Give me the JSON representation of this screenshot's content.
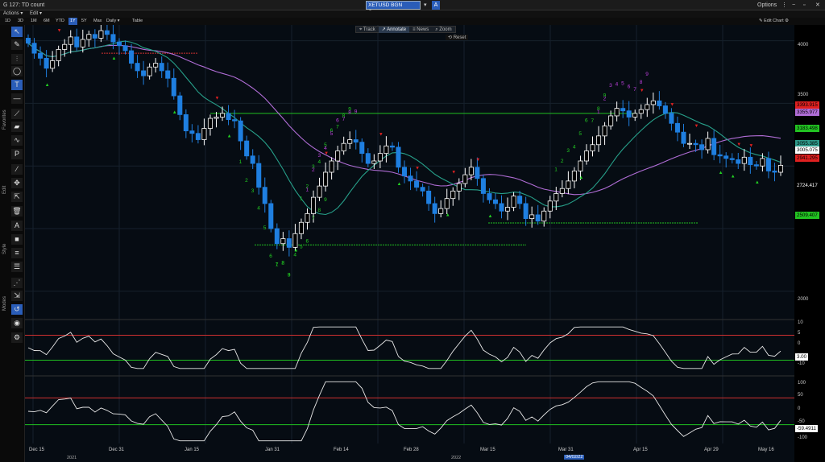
{
  "window": {
    "title": "G 127: TD count",
    "ticker": "XETUSD BGN Curncy",
    "ticker_badge": "A",
    "options_label": "Options",
    "btn_menu": "⋮",
    "btn_min": "−",
    "btn_max": "▫",
    "btn_close": "✕"
  },
  "menu": {
    "actions": "Actions ▾",
    "edit": "Edit ▾"
  },
  "ranges": [
    "1D",
    "3D",
    "1M",
    "6M",
    "YTD",
    "1Y",
    "5Y",
    "Max",
    "Daily ▾",
    "Table"
  ],
  "active_range": "1Y",
  "edit_chart": "✎ Edit Chart ⚙",
  "chart_toolbar": {
    "track": "⌖ Track",
    "annotate": "↗ Annotate",
    "news": "≡ News",
    "zoom": "⌕ Zoom",
    "reset": "⟲ Reset"
  },
  "sidebar": {
    "favorites_label": "Favorites",
    "edit_label": "Edit",
    "style_label": "Style",
    "modes_label": "Modes"
  },
  "colors": {
    "up_candle": "#ffffff",
    "down_candle": "#1f7fe0",
    "ma_fast": "#27a08a",
    "ma_slow": "#b06dd6",
    "resist_line": "#20c020",
    "red_line": "#d03030",
    "accent": "#2a5db8"
  },
  "price_labels": [
    {
      "text": "3393.915",
      "bg": "#e02020",
      "fg": "#000"
    },
    {
      "text": "3355.977",
      "bg": "#b06dd6",
      "fg": "#000"
    },
    {
      "text": "3183.498",
      "bg": "#22c322",
      "fg": "#000"
    },
    {
      "text": "3055.385",
      "bg": "#2e9a8a",
      "fg": "#000"
    },
    {
      "text": "3005.075",
      "bg": "#ffffff",
      "fg": "#000"
    },
    {
      "text": "2941.295",
      "bg": "#e02020",
      "fg": "#000"
    },
    {
      "text": "2724.417",
      "bg": "#000000",
      "fg": "#ffffff"
    },
    {
      "text": "2509.407",
      "bg": "#22c322",
      "fg": "#000"
    }
  ],
  "osc1_value": "3.00",
  "osc2_value": "-59.4911",
  "xaxis": {
    "labels": [
      "Dec 15",
      "Dec 31",
      "Jan 15",
      "Jan 31",
      "Feb 14",
      "Feb 28",
      "Mar 15",
      "Mar 31",
      "Apr 15",
      "Apr 29",
      "May 16"
    ],
    "years": [
      "2021",
      "2022"
    ],
    "cursor_date": "04/02/22"
  },
  "chart_data": {
    "type": "line",
    "ylim": [
      1800,
      4100
    ],
    "yticks": [
      2000,
      2500,
      3000,
      3500,
      4000
    ],
    "close": [
      3980,
      3900,
      3860,
      3780,
      3840,
      3930,
      3970,
      4030,
      3950,
      4010,
      4050,
      4020,
      4080,
      4050,
      3990,
      3960,
      3920,
      3820,
      3760,
      3720,
      3790,
      3820,
      3760,
      3700,
      3560,
      3410,
      3280,
      3260,
      3210,
      3300,
      3380,
      3390,
      3420,
      3370,
      3360,
      3200,
      3080,
      3020,
      2830,
      2700,
      2500,
      2380,
      2420,
      2350,
      2460,
      2550,
      2620,
      2750,
      2840,
      2950,
      3040,
      3120,
      3180,
      3210,
      3190,
      3100,
      3020,
      3040,
      3100,
      3160,
      3150,
      2990,
      2920,
      2880,
      2830,
      2800,
      2700,
      2620,
      2660,
      2740,
      2800,
      2860,
      2930,
      2990,
      2900,
      2780,
      2730,
      2700,
      2640,
      2670,
      2760,
      2700,
      2580,
      2610,
      2560,
      2640,
      2720,
      2780,
      2820,
      2880,
      2960,
      3040,
      3120,
      3170,
      3240,
      3320,
      3400,
      3460,
      3440,
      3390,
      3420,
      3450,
      3490,
      3520,
      3480,
      3420,
      3340,
      3270,
      3180,
      3180,
      3170,
      3130,
      3220,
      3090,
      3080,
      3060,
      3050,
      3020,
      3070,
      3010,
      3000,
      3060,
      2960,
      2950,
      3005
    ],
    "series": [
      {
        "name": "TD Setup (green)",
        "values": [
          1,
          2,
          3,
          4,
          5,
          6,
          7,
          8,
          9
        ]
      },
      {
        "name": "TD Setup (purple)",
        "values": [
          1,
          2,
          3,
          4,
          5,
          6,
          7,
          8,
          9
        ]
      }
    ],
    "osc1": {
      "ylim": [
        -12,
        12
      ],
      "upper": 6,
      "lower": -6,
      "last": 3.0
    },
    "osc2": {
      "ylim": [
        -120,
        120
      ],
      "upper": 50,
      "lower": -50,
      "last": -59.4911
    },
    "grid": true
  }
}
